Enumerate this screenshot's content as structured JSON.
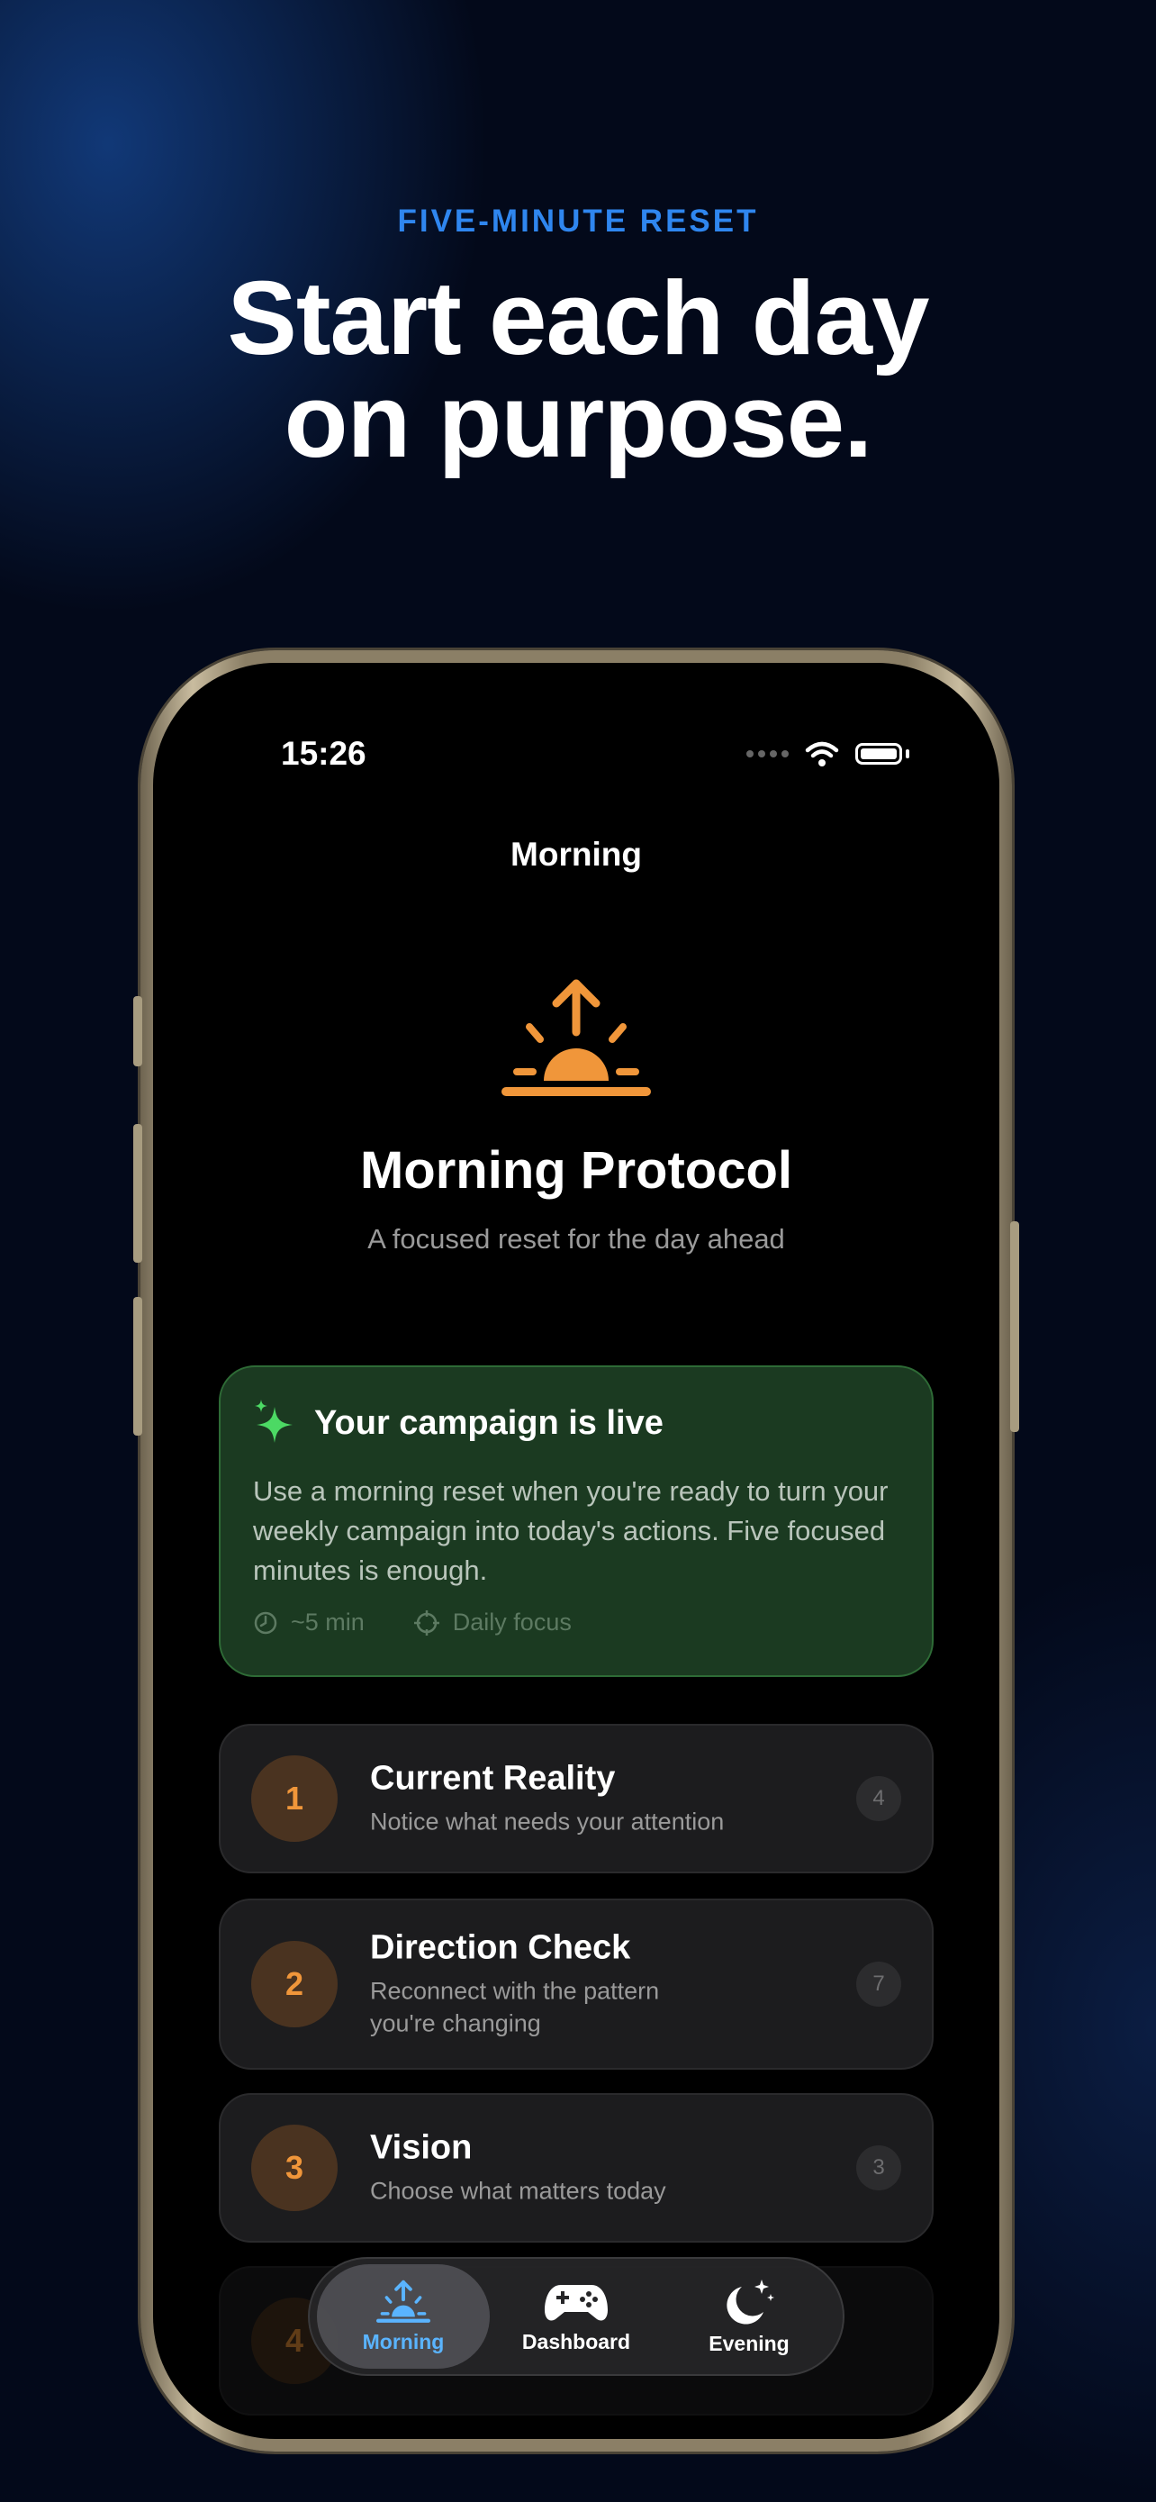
{
  "promo": {
    "eyebrow": "FIVE-MINUTE RESET",
    "headline_line1": "Start each day",
    "headline_line2": "on purpose."
  },
  "status_bar": {
    "time": "15:26"
  },
  "nav": {
    "title": "Morning"
  },
  "hero": {
    "icon": "sunrise-icon",
    "title": "Morning Protocol",
    "subtitle": "A focused reset for the day ahead"
  },
  "campaign_card": {
    "icon": "sparkles-icon",
    "title": "Your campaign is live",
    "body": "Use a morning reset when you're ready to turn your weekly campaign into today's actions. Five focused minutes is enough.",
    "duration": "~5 min",
    "focus": "Daily focus"
  },
  "steps": [
    {
      "number": "1",
      "title": "Current Reality",
      "description": "Notice what needs your attention",
      "count": "4"
    },
    {
      "number": "2",
      "title": "Direction Check",
      "description": "Reconnect with the pattern you're changing",
      "count": "7"
    },
    {
      "number": "3",
      "title": "Vision",
      "description": "Choose what matters today",
      "count": "3"
    },
    {
      "number": "4"
    }
  ],
  "tab_bar": {
    "tabs": [
      {
        "label": "Morning",
        "icon": "sunrise-icon",
        "active": true
      },
      {
        "label": "Dashboard",
        "icon": "gamepad-icon",
        "active": false
      },
      {
        "label": "Evening",
        "icon": "moon-stars-icon",
        "active": false
      }
    ]
  },
  "colors": {
    "accent_orange": "#f0963a",
    "accent_blue": "#2f86ef",
    "campaign_green": "#1b3a21",
    "sparkle_green": "#4cd964",
    "tab_active": "#5ab4ff"
  }
}
